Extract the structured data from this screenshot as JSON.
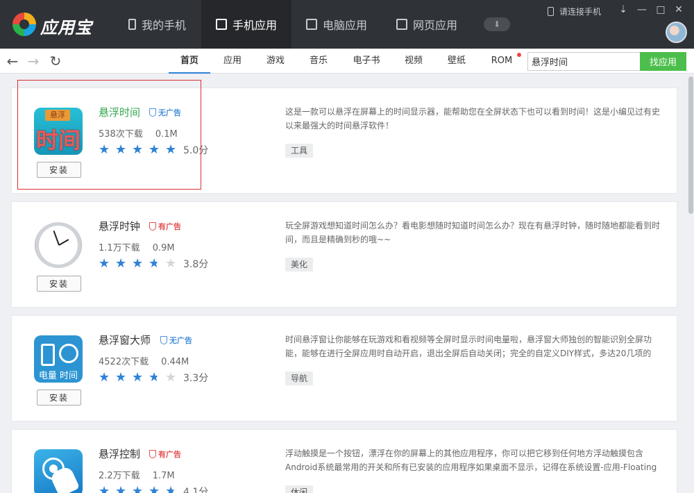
{
  "app": {
    "title": "应用宝"
  },
  "main_tabs": [
    {
      "label": "我的手机",
      "icon": "phone-icon"
    },
    {
      "label": "手机应用",
      "icon": "bag-icon",
      "active": true
    },
    {
      "label": "电脑应用",
      "icon": "monitor-icon"
    },
    {
      "label": "网页应用",
      "icon": "web-page-icon"
    }
  ],
  "window": {
    "connect_label": "请连接手机",
    "menu_glyph": "⇣",
    "minimize_glyph": "—",
    "maximize_glyph": "□",
    "close_glyph": "✕",
    "download_glyph": "⬇"
  },
  "nav": {
    "back_glyph": "←",
    "forward_glyph": "→",
    "refresh_glyph": "↻"
  },
  "categories": [
    "首页",
    "应用",
    "游戏",
    "音乐",
    "电子书",
    "视频",
    "壁纸",
    "ROM"
  ],
  "active_category": "首页",
  "search": {
    "value": "悬浮时间",
    "button_label": "找应用"
  },
  "install_label": "安装",
  "apps": [
    {
      "name": "悬浮时间",
      "ad_label": "无广告",
      "ad_type": "no-ads",
      "downloads": "538次下载",
      "size": "0.1M",
      "rating": 5.0,
      "score": "5.0分",
      "description": "这是一款可以悬浮在屏幕上的时间显示器，能帮助您在全屏状态下也可以看到时间！这是小编见过有史以来最强大的时间悬浮软件！",
      "tag": "工具",
      "icon_text_top": "悬浮",
      "icon_text_main": "时间",
      "highlighted": true
    },
    {
      "name": "悬浮时钟",
      "ad_label": "有广告",
      "ad_type": "has-ads",
      "downloads": "1.1万下载",
      "size": "0.9M",
      "rating": 3.8,
      "score": "3.8分",
      "description": "玩全屏游戏想知道时间怎么办？看电影想随时知道时间怎么办？现在有悬浮时钟，随时随地都能看到时间，而且是精确到秒的哦~~",
      "tag": "美化"
    },
    {
      "name": "悬浮窗大师",
      "ad_label": "无广告",
      "ad_type": "no-ads",
      "downloads": "4522次下载",
      "size": "0.44M",
      "rating": 3.3,
      "score": "3.3分",
      "description": "时间悬浮窗让你能够在玩游戏和看视频等全屏时显示时间电量啦，悬浮窗大师独创的智能识别全屏功能，能够在进行全屏应用时自动开启，退出全屏后自动关闭；完全的自定义DIY样式，多达20几项的",
      "tag": "导航",
      "icon_text_main": "电量 时间"
    },
    {
      "name": "悬浮控制",
      "ad_label": "有广告",
      "ad_type": "has-ads",
      "downloads": "2.2万下载",
      "size": "1.7M",
      "rating": 4.1,
      "score": "4.1分",
      "description": "浮动触摸是一个按钮，漂浮在你的屏幕上的其他应用程序，你可以把它移到任何地方浮动触摸包含Android系统最常用的开关和所有已安装的应用程序如果桌面不显示，记得在系统设置-应用-Floating",
      "tag": "休闲"
    }
  ],
  "colors": {
    "accent": "#2f82d6",
    "green": "#4cbe4c",
    "topbar": "#2f3237",
    "ad_warning": "#e25151",
    "no_ad": "#4a90d9"
  }
}
